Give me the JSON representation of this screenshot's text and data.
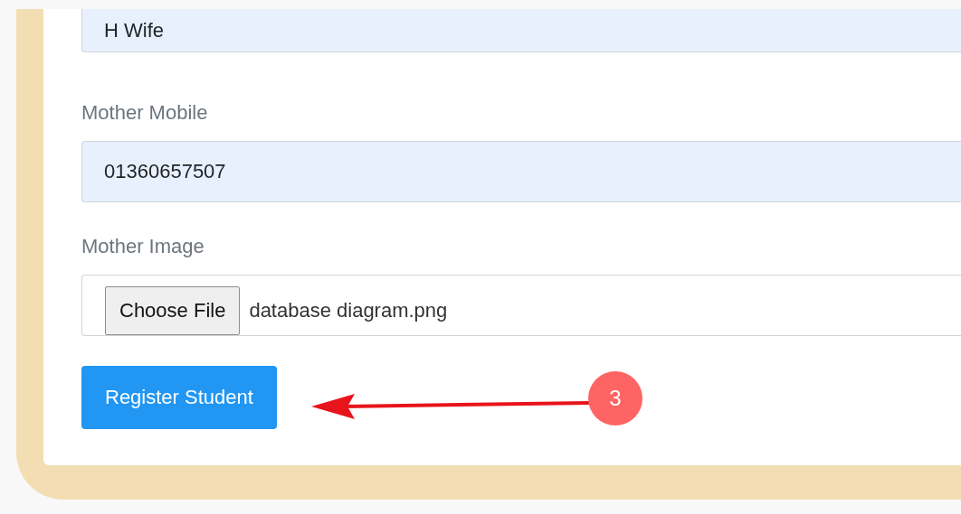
{
  "fields": [
    {
      "kind": "text",
      "value": "H Wife"
    },
    {
      "kind": "text",
      "label": "Mother Mobile",
      "value": "01360657507"
    },
    {
      "kind": "file",
      "label": "Mother Image",
      "button": "Choose File",
      "value": "database diagram.png"
    }
  ],
  "submit": {
    "label": "Register Student"
  },
  "annotation": {
    "number": "3"
  }
}
